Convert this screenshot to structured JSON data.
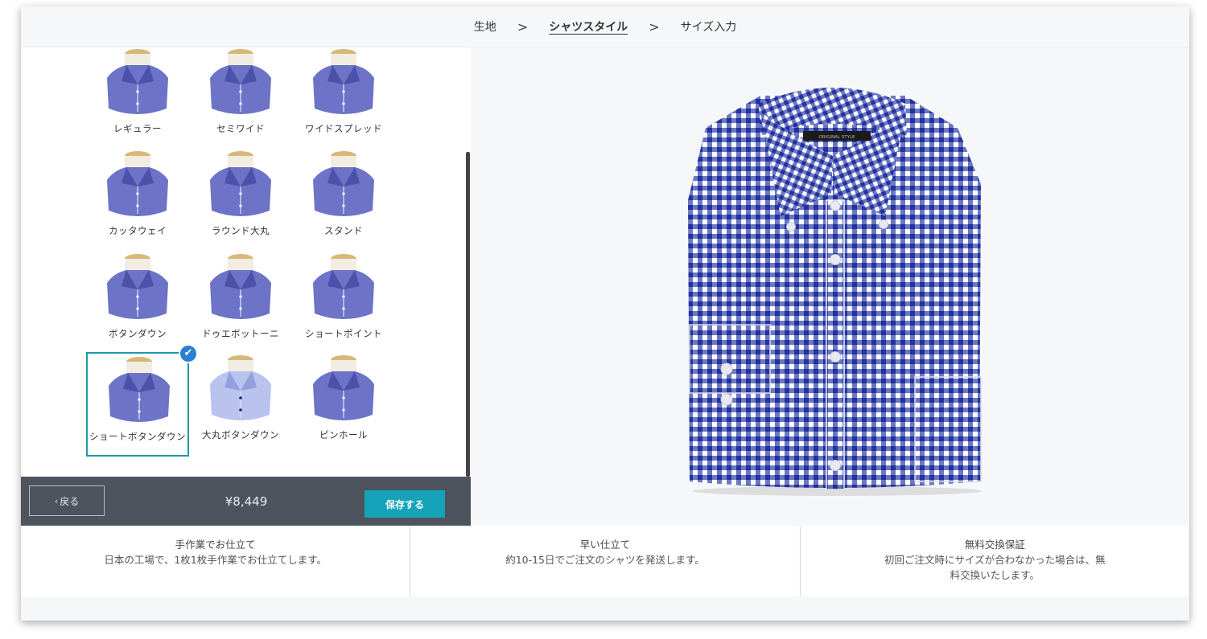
{
  "steps": [
    {
      "label": "生地",
      "active": false
    },
    {
      "label": "シャツスタイル",
      "active": true
    },
    {
      "label": "サイズ入力",
      "active": false
    }
  ],
  "separator": ">",
  "collars": [
    {
      "label": "レギュラー",
      "style": "regular",
      "selected": false
    },
    {
      "label": "セミワイド",
      "style": "semiwide",
      "selected": false
    },
    {
      "label": "ワイドスプレッド",
      "style": "wide",
      "selected": false
    },
    {
      "label": "カッタウェイ",
      "style": "cutaway",
      "selected": false
    },
    {
      "label": "ラウンド大丸",
      "style": "round",
      "selected": false
    },
    {
      "label": "スタンド",
      "style": "stand",
      "selected": false
    },
    {
      "label": "ボタンダウン",
      "style": "buttondown",
      "selected": false
    },
    {
      "label": "ドゥエボットーニ",
      "style": "duebottoni",
      "selected": false
    },
    {
      "label": "ショートポイント",
      "style": "shortpoint",
      "selected": false
    },
    {
      "label": "ショートボタンダウン",
      "style": "shortbuttondown",
      "selected": true
    },
    {
      "label": "大丸ボタンダウン",
      "style": "roundbuttondown",
      "selected": false
    },
    {
      "label": "ピンホール",
      "style": "pinhole",
      "selected": false
    }
  ],
  "action_bar": {
    "back_label": "戻る",
    "back_icon": "chevron-left-icon",
    "price": "¥8,449",
    "save_label": "保存する"
  },
  "shirt": {
    "label_text": "ORIGINAL STYLE",
    "fabric": "blue gingham check",
    "colors": {
      "check": "#2a3a9e",
      "white": "#ffffff"
    }
  },
  "features": [
    {
      "title": "手作業でお仕立て",
      "desc": "日本の工場で、1枚1枚手作業でお仕立てします。"
    },
    {
      "title": "早い仕立て",
      "desc": "約10-15日でご注文のシャツを発送します。"
    },
    {
      "title": "無料交換保証",
      "desc": "初回ご注文時にサイズが合わなかった場合は、無料交換いたします。"
    }
  ],
  "colors": {
    "accent": "#14a3b8",
    "check_badge": "#2a7fd4",
    "action_bar": "#4d545d"
  }
}
